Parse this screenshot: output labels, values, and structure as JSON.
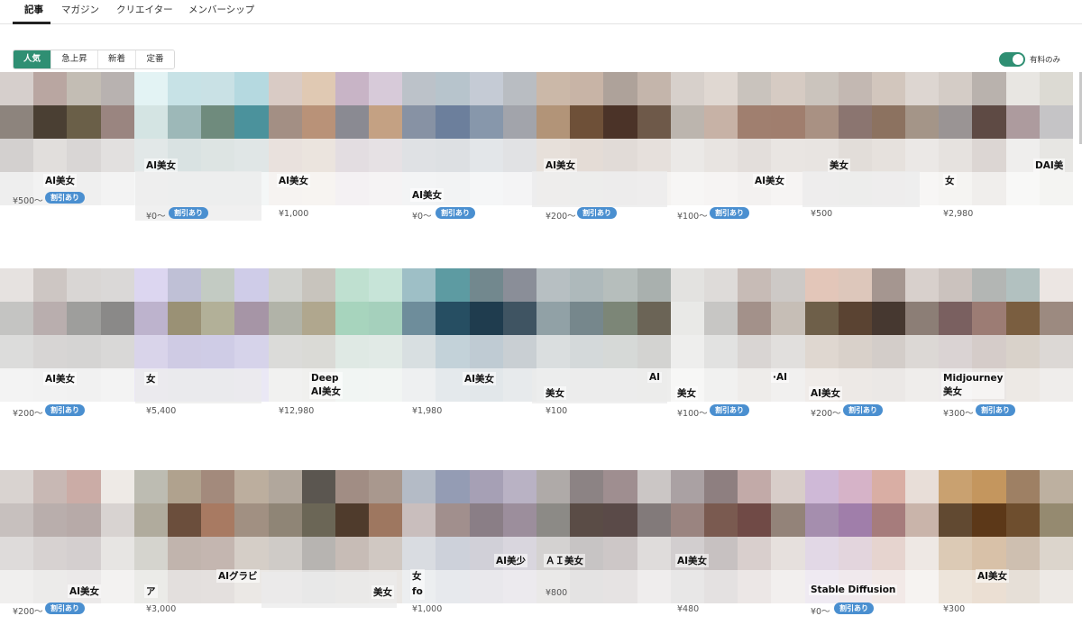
{
  "nav": {
    "tabs": [
      "記事",
      "マガジン",
      "クリエイター",
      "メンバーシップ"
    ]
  },
  "sort": {
    "options": [
      "人気",
      "急上昇",
      "新着",
      "定番"
    ],
    "active": "人気"
  },
  "filter": {
    "paid_only_label": "有料のみ",
    "paid_only_on": true
  },
  "discount_badge": "割引あり",
  "rows": [
    {
      "cards": [
        {
          "title": "AI美女",
          "price": "¥500〜",
          "discount": true
        },
        {
          "title": "AI美女",
          "price": "¥0〜",
          "discount": true
        },
        {
          "title": "AI美女",
          "price": "¥1,000",
          "discount": false
        },
        {
          "title": "AI美女",
          "price": "¥0〜",
          "discount": true
        },
        {
          "title": "AI美女",
          "price": "¥200〜",
          "discount": true
        },
        {
          "title": "AI美女",
          "price": "¥100〜",
          "discount": true
        },
        {
          "title": "美女",
          "price": "¥500",
          "discount": false
        },
        {
          "title": "女",
          "price": "¥2,980",
          "discount": false
        }
      ],
      "extra_texts": [
        "AI美女",
        "DAI美"
      ]
    },
    {
      "cards": [
        {
          "title": "AI美女",
          "price": "¥200〜",
          "discount": true
        },
        {
          "title": "女",
          "price": "¥5,400",
          "discount": false
        },
        {
          "title": "Deep\nAI美女",
          "price": "¥12,980",
          "discount": false
        },
        {
          "title": "AI美女",
          "price": "¥1,980",
          "discount": false
        },
        {
          "title": "美女",
          "price": "¥100",
          "discount": false
        },
        {
          "title": "美女",
          "price": "¥100〜",
          "discount": true
        },
        {
          "title": "AI美女",
          "price": "¥200〜",
          "discount": true
        },
        {
          "title": "Midjourney\n美女",
          "price": "¥300〜",
          "discount": true
        }
      ],
      "extra_texts": [
        "AI",
        "·AI"
      ]
    },
    {
      "cards": [
        {
          "title": "AI美女",
          "price": "¥200〜",
          "discount": true
        },
        {
          "title": "ア",
          "price": "¥3,000",
          "discount": false
        },
        {
          "title": "美女",
          "price": "",
          "discount": false
        },
        {
          "title": "女\nfo",
          "price": "¥1,000",
          "discount": false
        },
        {
          "title": "ＡＩ美女",
          "price": "¥800",
          "discount": false
        },
        {
          "title": "AI美女",
          "price": "¥480",
          "discount": false
        },
        {
          "title": "Stable Diffusion",
          "price": "¥0〜",
          "discount": true
        },
        {
          "title": "AI美女",
          "price": "¥300",
          "discount": false
        }
      ],
      "extra_texts": [
        "AIグラビ",
        "AI美少"
      ]
    }
  ]
}
